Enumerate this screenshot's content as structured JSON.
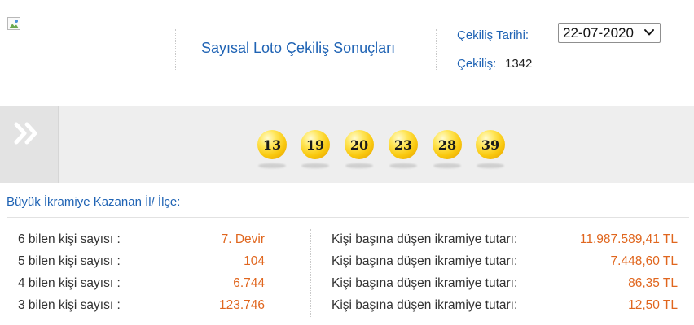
{
  "header": {
    "logo_icon": "broken-image-icon",
    "title": "Sayısal Loto Çekiliş Sonuçları",
    "draw_date_label": "Çekiliş Tarihi:",
    "draw_date_value": "22-07-2020",
    "draw_number_label": "Çekiliş:",
    "draw_number_value": "1342"
  },
  "results": {
    "icon": "double-chevron-right-icon",
    "numbers": [
      "13",
      "19",
      "20",
      "23",
      "28",
      "39"
    ]
  },
  "winners": {
    "title": "Büyük İkramiye Kazanan İl/ İlçe:",
    "rows": [
      {
        "label": "6 bilen kişi sayısı :",
        "count": "7. Devir",
        "prize_label": "Kişi başına düşen ikramiye tutarı:",
        "prize": "11.987.589,41 TL"
      },
      {
        "label": "5 bilen kişi sayısı :",
        "count": "104",
        "prize_label": "Kişi başına düşen ikramiye tutarı:",
        "prize": "7.448,60 TL"
      },
      {
        "label": "4 bilen kişi sayısı :",
        "count": "6.744",
        "prize_label": "Kişi başına düşen ikramiye tutarı:",
        "prize": "86,35 TL"
      },
      {
        "label": "3 bilen kişi sayısı :",
        "count": "123.746",
        "prize_label": "Kişi başına düşen ikramiye tutarı:",
        "prize": "12,50 TL"
      }
    ]
  },
  "colors": {
    "accent_blue": "#1f63b4",
    "value_orange": "#e0661e",
    "ball_yellow": "#f9c80e"
  }
}
